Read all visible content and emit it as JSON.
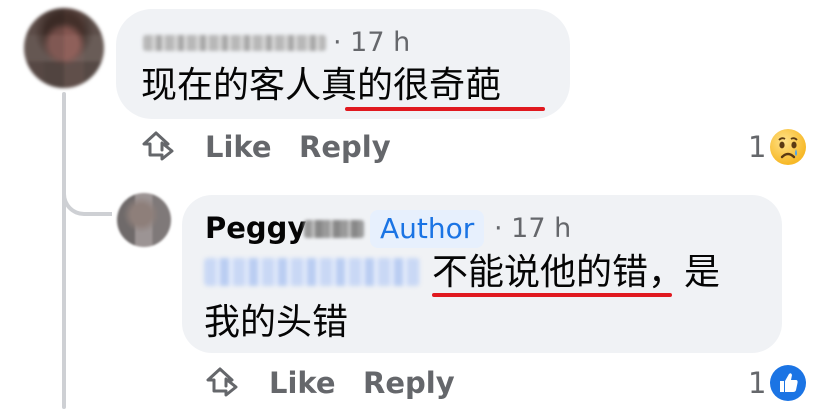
{
  "top_comment": {
    "time": "· 17 h",
    "text": "现在的客人真的很奇葩",
    "actions": {
      "like": "Like",
      "reply": "Reply"
    },
    "reaction_count": "1",
    "reaction_icon": "sad-face-icon"
  },
  "reply_comment": {
    "author_first_name": "Peggy",
    "author_badge": "Author",
    "time": "· 17 h",
    "text_line1": "不能说他的错，是",
    "text_line2": "我的头错",
    "actions": {
      "like": "Like",
      "reply": "Reply"
    },
    "reaction_count": "1",
    "reaction_icon": "like-thumb-icon"
  },
  "colors": {
    "bubble": "#f0f2f5",
    "meta_text": "#65676b",
    "badge_text": "#1b74e4",
    "badge_bg": "#e7f0fd",
    "annotation_underline": "#e0191f"
  }
}
